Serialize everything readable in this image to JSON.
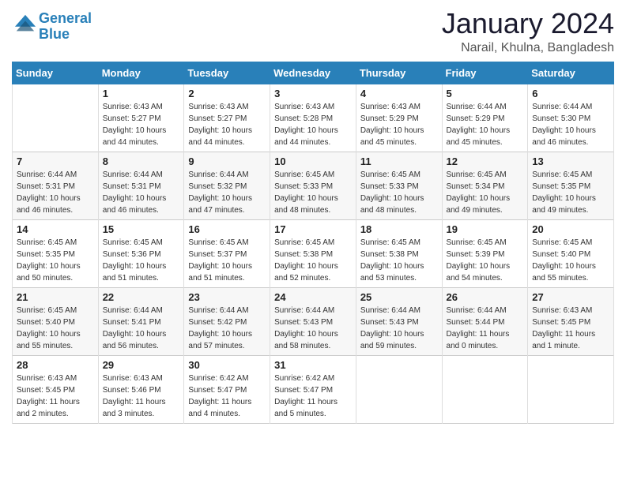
{
  "header": {
    "logo_line1": "General",
    "logo_line2": "Blue",
    "month": "January 2024",
    "location": "Narail, Khulna, Bangladesh"
  },
  "days_of_week": [
    "Sunday",
    "Monday",
    "Tuesday",
    "Wednesday",
    "Thursday",
    "Friday",
    "Saturday"
  ],
  "weeks": [
    [
      {
        "num": "",
        "sunrise": "",
        "sunset": "",
        "daylight": ""
      },
      {
        "num": "1",
        "sunrise": "Sunrise: 6:43 AM",
        "sunset": "Sunset: 5:27 PM",
        "daylight": "Daylight: 10 hours and 44 minutes."
      },
      {
        "num": "2",
        "sunrise": "Sunrise: 6:43 AM",
        "sunset": "Sunset: 5:27 PM",
        "daylight": "Daylight: 10 hours and 44 minutes."
      },
      {
        "num": "3",
        "sunrise": "Sunrise: 6:43 AM",
        "sunset": "Sunset: 5:28 PM",
        "daylight": "Daylight: 10 hours and 44 minutes."
      },
      {
        "num": "4",
        "sunrise": "Sunrise: 6:43 AM",
        "sunset": "Sunset: 5:29 PM",
        "daylight": "Daylight: 10 hours and 45 minutes."
      },
      {
        "num": "5",
        "sunrise": "Sunrise: 6:44 AM",
        "sunset": "Sunset: 5:29 PM",
        "daylight": "Daylight: 10 hours and 45 minutes."
      },
      {
        "num": "6",
        "sunrise": "Sunrise: 6:44 AM",
        "sunset": "Sunset: 5:30 PM",
        "daylight": "Daylight: 10 hours and 46 minutes."
      }
    ],
    [
      {
        "num": "7",
        "sunrise": "Sunrise: 6:44 AM",
        "sunset": "Sunset: 5:31 PM",
        "daylight": "Daylight: 10 hours and 46 minutes."
      },
      {
        "num": "8",
        "sunrise": "Sunrise: 6:44 AM",
        "sunset": "Sunset: 5:31 PM",
        "daylight": "Daylight: 10 hours and 46 minutes."
      },
      {
        "num": "9",
        "sunrise": "Sunrise: 6:44 AM",
        "sunset": "Sunset: 5:32 PM",
        "daylight": "Daylight: 10 hours and 47 minutes."
      },
      {
        "num": "10",
        "sunrise": "Sunrise: 6:45 AM",
        "sunset": "Sunset: 5:33 PM",
        "daylight": "Daylight: 10 hours and 48 minutes."
      },
      {
        "num": "11",
        "sunrise": "Sunrise: 6:45 AM",
        "sunset": "Sunset: 5:33 PM",
        "daylight": "Daylight: 10 hours and 48 minutes."
      },
      {
        "num": "12",
        "sunrise": "Sunrise: 6:45 AM",
        "sunset": "Sunset: 5:34 PM",
        "daylight": "Daylight: 10 hours and 49 minutes."
      },
      {
        "num": "13",
        "sunrise": "Sunrise: 6:45 AM",
        "sunset": "Sunset: 5:35 PM",
        "daylight": "Daylight: 10 hours and 49 minutes."
      }
    ],
    [
      {
        "num": "14",
        "sunrise": "Sunrise: 6:45 AM",
        "sunset": "Sunset: 5:35 PM",
        "daylight": "Daylight: 10 hours and 50 minutes."
      },
      {
        "num": "15",
        "sunrise": "Sunrise: 6:45 AM",
        "sunset": "Sunset: 5:36 PM",
        "daylight": "Daylight: 10 hours and 51 minutes."
      },
      {
        "num": "16",
        "sunrise": "Sunrise: 6:45 AM",
        "sunset": "Sunset: 5:37 PM",
        "daylight": "Daylight: 10 hours and 51 minutes."
      },
      {
        "num": "17",
        "sunrise": "Sunrise: 6:45 AM",
        "sunset": "Sunset: 5:38 PM",
        "daylight": "Daylight: 10 hours and 52 minutes."
      },
      {
        "num": "18",
        "sunrise": "Sunrise: 6:45 AM",
        "sunset": "Sunset: 5:38 PM",
        "daylight": "Daylight: 10 hours and 53 minutes."
      },
      {
        "num": "19",
        "sunrise": "Sunrise: 6:45 AM",
        "sunset": "Sunset: 5:39 PM",
        "daylight": "Daylight: 10 hours and 54 minutes."
      },
      {
        "num": "20",
        "sunrise": "Sunrise: 6:45 AM",
        "sunset": "Sunset: 5:40 PM",
        "daylight": "Daylight: 10 hours and 55 minutes."
      }
    ],
    [
      {
        "num": "21",
        "sunrise": "Sunrise: 6:45 AM",
        "sunset": "Sunset: 5:40 PM",
        "daylight": "Daylight: 10 hours and 55 minutes."
      },
      {
        "num": "22",
        "sunrise": "Sunrise: 6:44 AM",
        "sunset": "Sunset: 5:41 PM",
        "daylight": "Daylight: 10 hours and 56 minutes."
      },
      {
        "num": "23",
        "sunrise": "Sunrise: 6:44 AM",
        "sunset": "Sunset: 5:42 PM",
        "daylight": "Daylight: 10 hours and 57 minutes."
      },
      {
        "num": "24",
        "sunrise": "Sunrise: 6:44 AM",
        "sunset": "Sunset: 5:43 PM",
        "daylight": "Daylight: 10 hours and 58 minutes."
      },
      {
        "num": "25",
        "sunrise": "Sunrise: 6:44 AM",
        "sunset": "Sunset: 5:43 PM",
        "daylight": "Daylight: 10 hours and 59 minutes."
      },
      {
        "num": "26",
        "sunrise": "Sunrise: 6:44 AM",
        "sunset": "Sunset: 5:44 PM",
        "daylight": "Daylight: 11 hours and 0 minutes."
      },
      {
        "num": "27",
        "sunrise": "Sunrise: 6:43 AM",
        "sunset": "Sunset: 5:45 PM",
        "daylight": "Daylight: 11 hours and 1 minute."
      }
    ],
    [
      {
        "num": "28",
        "sunrise": "Sunrise: 6:43 AM",
        "sunset": "Sunset: 5:45 PM",
        "daylight": "Daylight: 11 hours and 2 minutes."
      },
      {
        "num": "29",
        "sunrise": "Sunrise: 6:43 AM",
        "sunset": "Sunset: 5:46 PM",
        "daylight": "Daylight: 11 hours and 3 minutes."
      },
      {
        "num": "30",
        "sunrise": "Sunrise: 6:42 AM",
        "sunset": "Sunset: 5:47 PM",
        "daylight": "Daylight: 11 hours and 4 minutes."
      },
      {
        "num": "31",
        "sunrise": "Sunrise: 6:42 AM",
        "sunset": "Sunset: 5:47 PM",
        "daylight": "Daylight: 11 hours and 5 minutes."
      },
      {
        "num": "",
        "sunrise": "",
        "sunset": "",
        "daylight": ""
      },
      {
        "num": "",
        "sunrise": "",
        "sunset": "",
        "daylight": ""
      },
      {
        "num": "",
        "sunrise": "",
        "sunset": "",
        "daylight": ""
      }
    ]
  ]
}
